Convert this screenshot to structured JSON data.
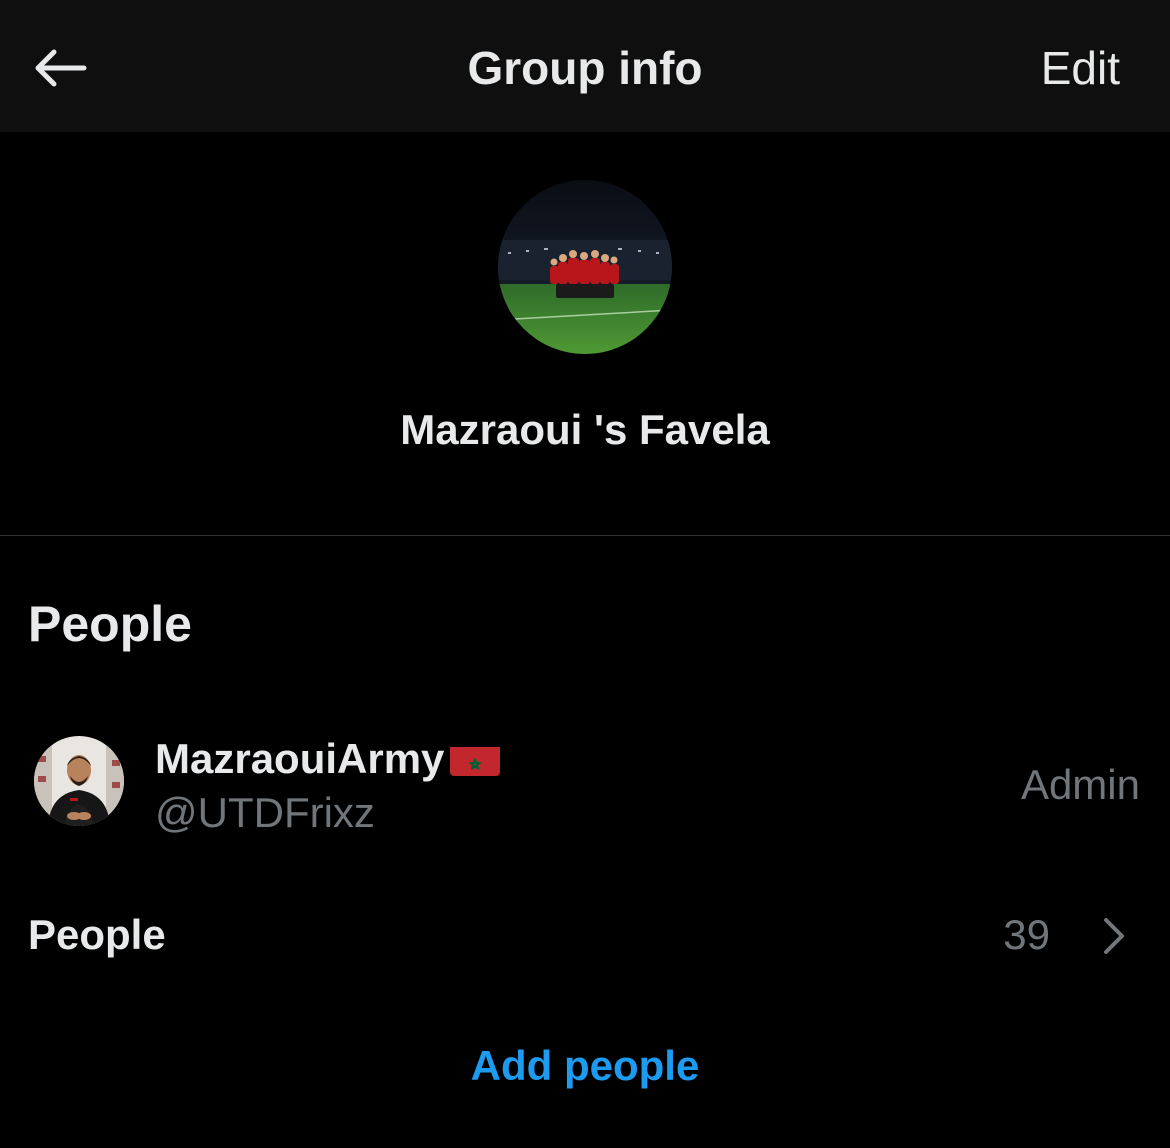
{
  "header": {
    "back_icon": "arrow-left-icon",
    "title": "Group info",
    "edit_label": "Edit"
  },
  "group": {
    "name": "Mazraoui 's Favela"
  },
  "people_section": {
    "heading": "People",
    "members": [
      {
        "display_name": "MazraouiArmy",
        "flag_icon": "morocco-flag-icon",
        "handle": "@UTDFrixz",
        "role": "Admin"
      }
    ],
    "people_row": {
      "label": "People",
      "count": "39",
      "chevron_icon": "chevron-right-icon"
    },
    "add_people_label": "Add people"
  },
  "colors": {
    "background": "#000000",
    "header_background": "#0f0f0f",
    "primary_text": "#e7e9ea",
    "secondary_text": "#71767b",
    "accent": "#1d9bf0",
    "divider": "#2f3336"
  }
}
